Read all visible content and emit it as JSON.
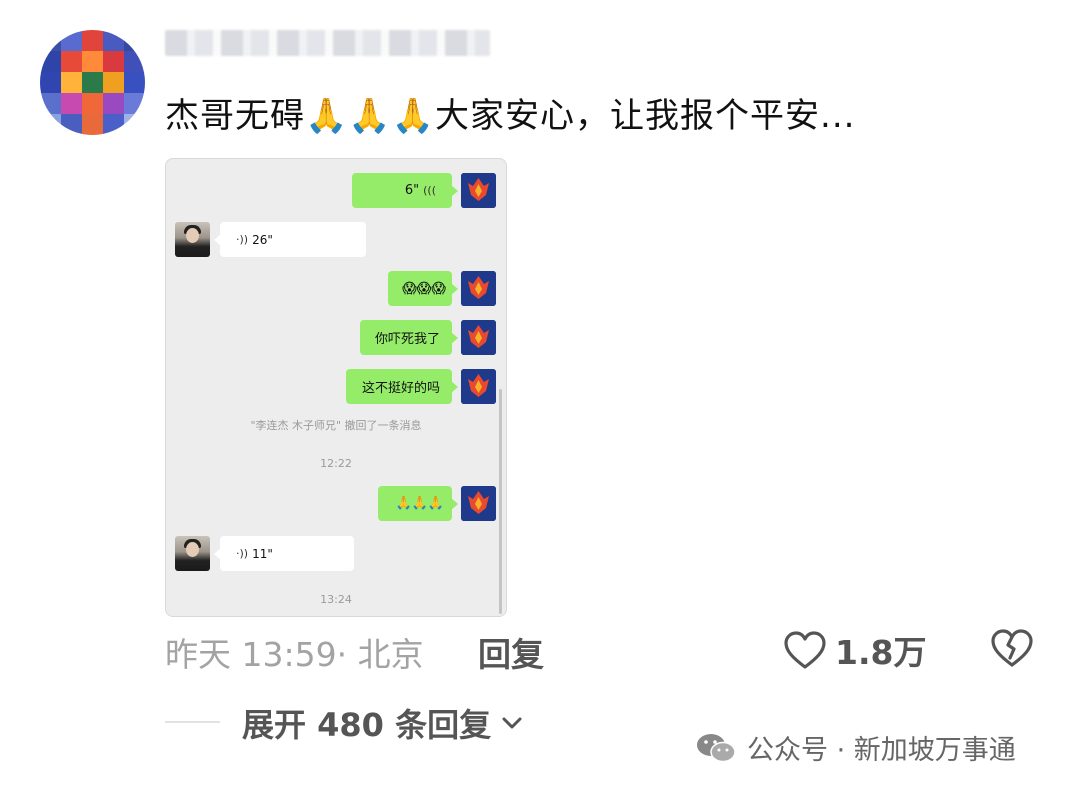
{
  "comment": {
    "username": "",
    "text_before": "杰哥无碍",
    "emoji": "🙏",
    "text_after": "大家安心，让我报个平安..."
  },
  "chat": {
    "msg1_duration": "6\"",
    "msg2_duration": "26\"",
    "msg3_text": "😱😱😱",
    "msg4_text": "你吓死我了",
    "msg5_text": "这不挺好的吗",
    "system_notice": "\"李连杰 木子师兄\" 撤回了一条消息",
    "time1": "12:22",
    "msg6_text": "🙏🙏🙏",
    "msg7_duration": "11\"",
    "time2": "13:24"
  },
  "meta": {
    "time_location": "昨天 13:59· 北京",
    "reply_label": "回复",
    "like_count": "1.8万"
  },
  "expand_label": "展开 480 条回复",
  "watermark": "公众号 · 新加坡万事通",
  "colors": {
    "bubble_green": "#95ec69",
    "chat_bg": "#ededed",
    "meta_gray": "#a3a3a3"
  }
}
